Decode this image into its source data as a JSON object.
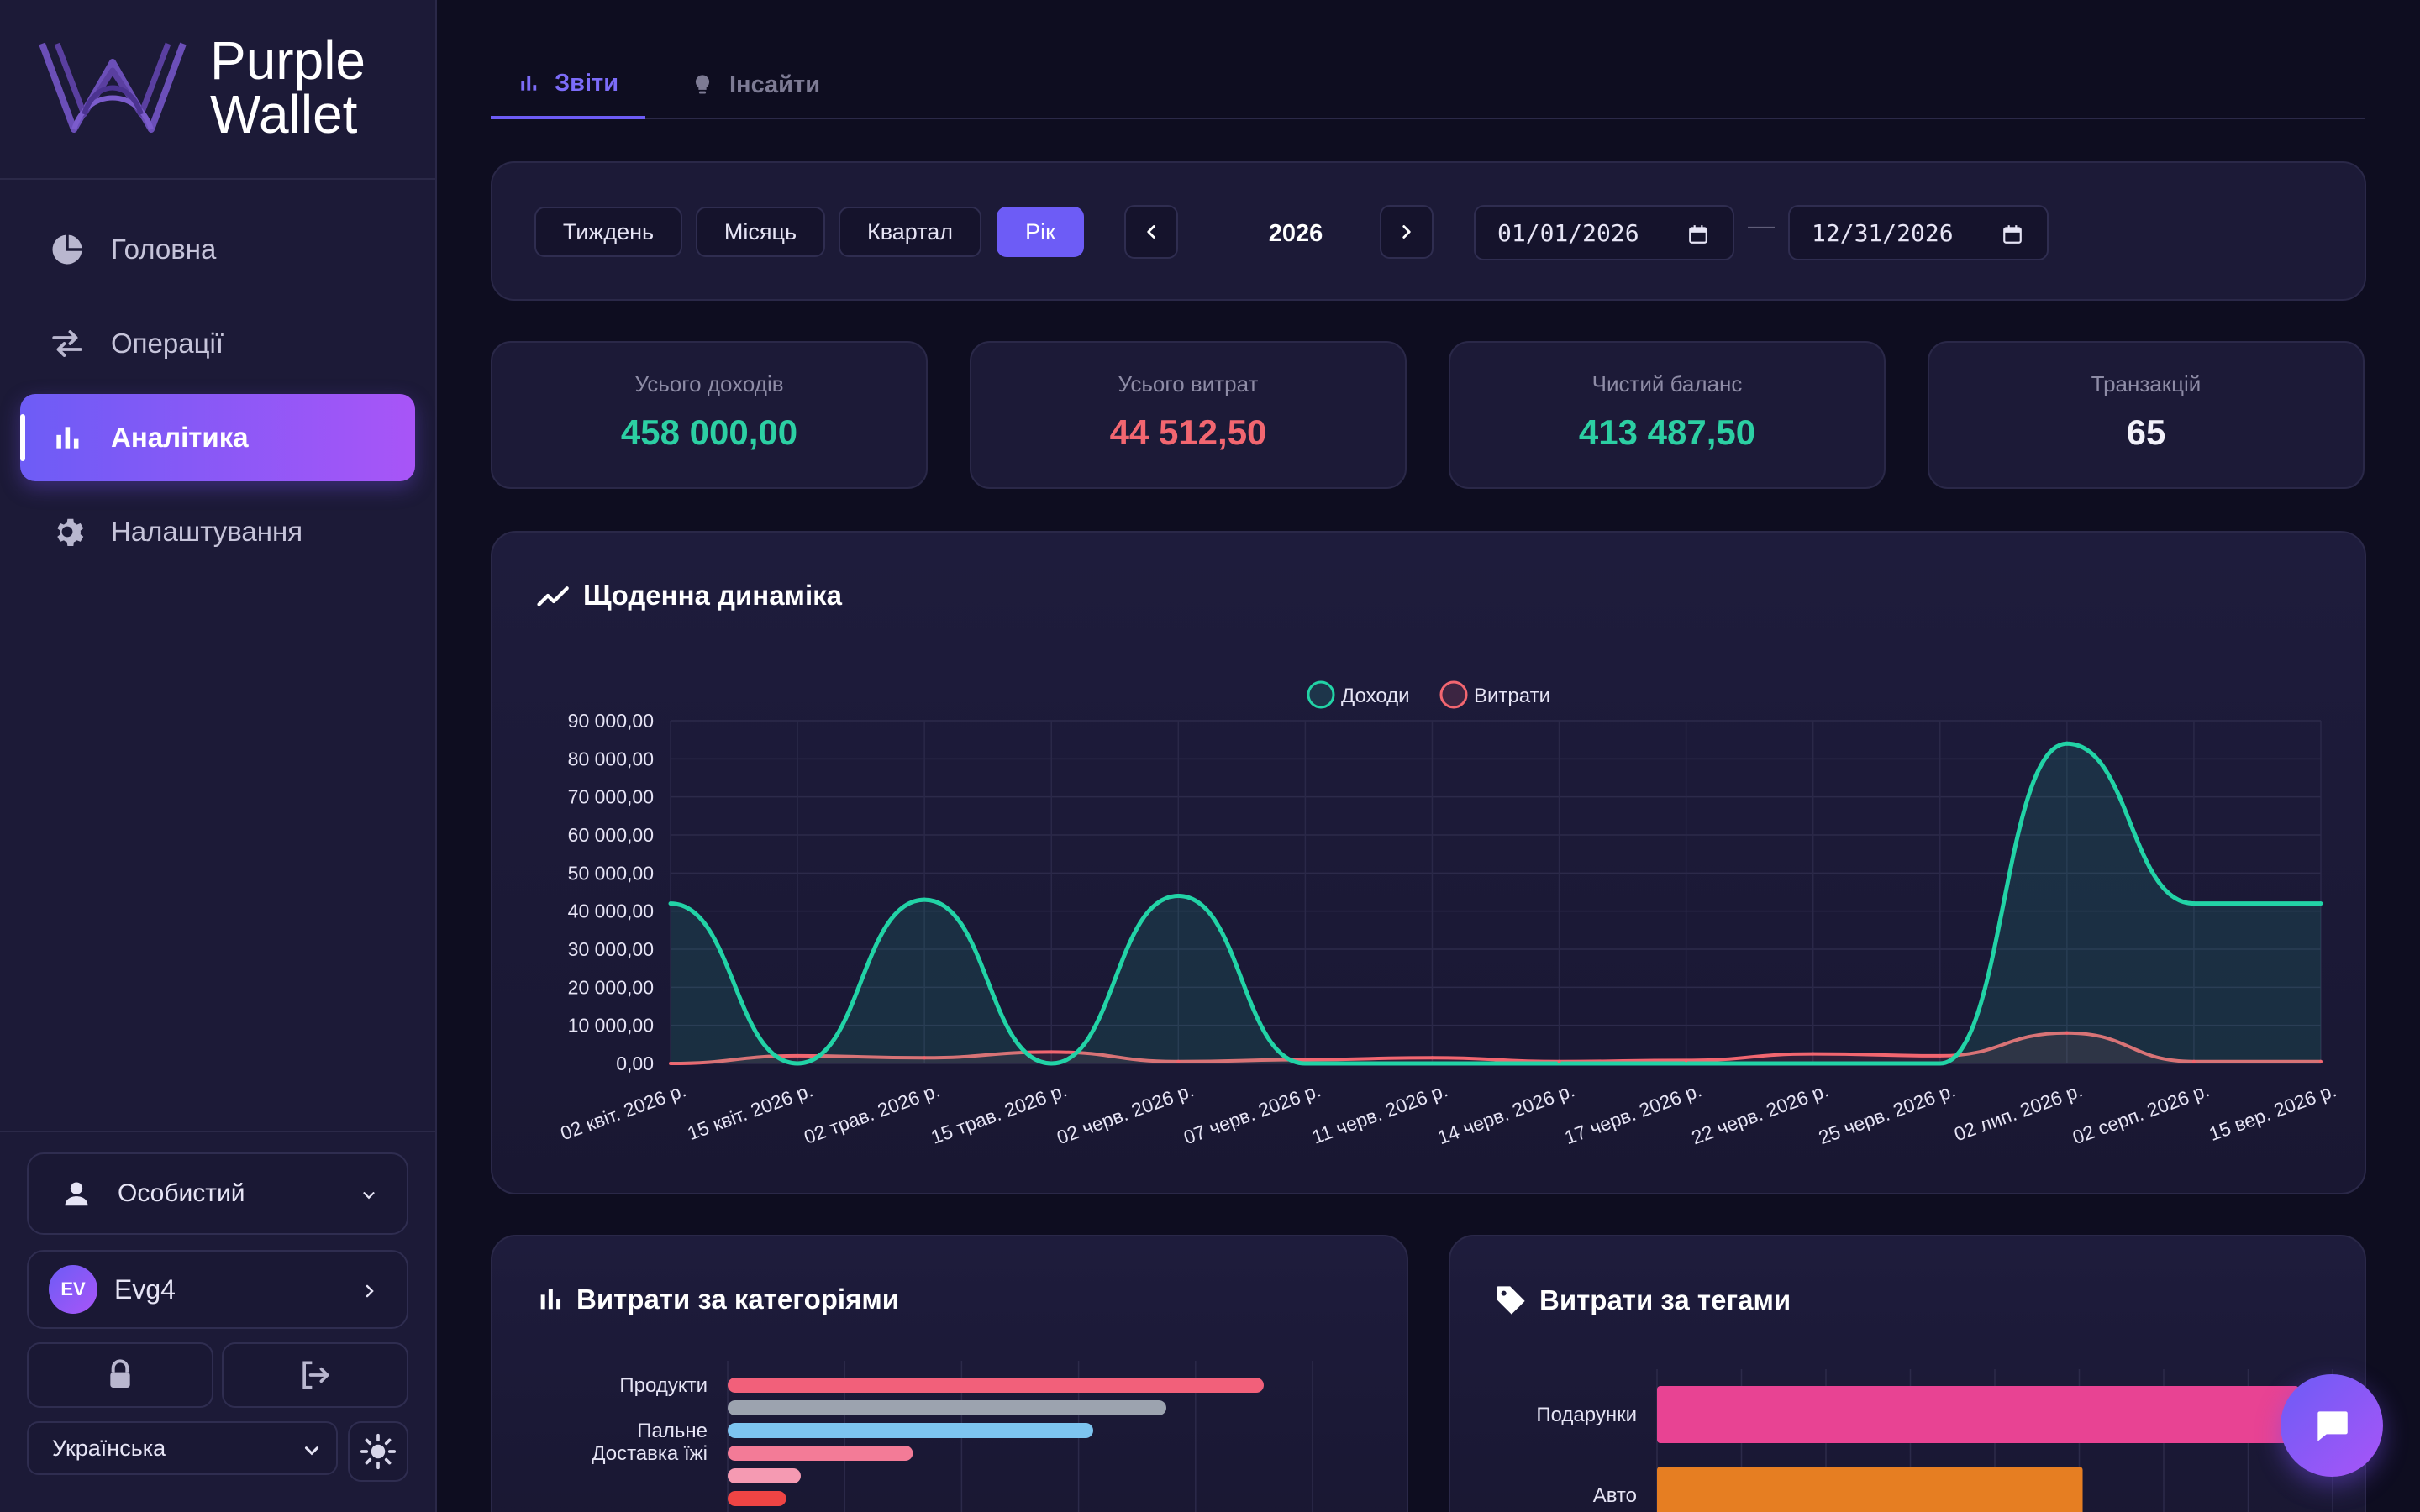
{
  "brand": {
    "line1": "Purple",
    "line2": "Wallet"
  },
  "sidebar": {
    "items": [
      {
        "label": "Головна",
        "icon": "pie-chart-icon"
      },
      {
        "label": "Операції",
        "icon": "swap-arrows-icon"
      },
      {
        "label": "Аналітика",
        "icon": "bar-chart-icon",
        "active": true
      },
      {
        "label": "Налаштування",
        "icon": "gear-icon"
      }
    ],
    "profile": "Особистий",
    "user": {
      "initials": "EV",
      "name": "Evg4"
    },
    "language": "Українська"
  },
  "tabs": [
    {
      "label": "Звіти",
      "active": true,
      "icon": "bar-chart-icon"
    },
    {
      "label": "Інсайти",
      "active": false,
      "icon": "lightbulb-icon"
    }
  ],
  "filters": {
    "periods": [
      "Тиждень",
      "Місяць",
      "Квартал",
      "Рік"
    ],
    "active_period": "Рік",
    "year": "2026",
    "date_from": "01/01/2026",
    "date_to": "12/31/2026",
    "separator": "—"
  },
  "stats": [
    {
      "label": "Усього доходів",
      "value": "458 000,00",
      "color": "#2ccfa3"
    },
    {
      "label": "Усього витрат",
      "value": "44 512,50",
      "color": "#f26670"
    },
    {
      "label": "Чистий баланс",
      "value": "413 487,50",
      "color": "#2ccfa3"
    },
    {
      "label": "Транзакцій",
      "value": "65",
      "color": "#f2f1fa"
    }
  ],
  "daily_chart": {
    "title": "Щоденна динаміка",
    "legend": [
      "Доходи",
      "Витрати"
    ],
    "colors": {
      "income": "#22d3a6",
      "expense": "#f26670"
    }
  },
  "category_chart": {
    "title": "Витрати за категоріями",
    "labels": [
      "Продукти",
      "Пальне",
      "Доставка їжі"
    ]
  },
  "tags_chart": {
    "title": "Витрати за тегами",
    "labels": [
      "Подарунки",
      "Авто"
    ]
  },
  "chart_data": [
    {
      "type": "line",
      "title": "Щоденна динаміка",
      "x": [
        "02 квіт. 2026 р.",
        "15 квіт. 2026 р.",
        "02 трав. 2026 р.",
        "15 трав. 2026 р.",
        "02 черв. 2026 р.",
        "07 черв. 2026 р.",
        "11 черв. 2026 р.",
        "14 черв. 2026 р.",
        "17 черв. 2026 р.",
        "22 черв. 2026 р.",
        "25 черв. 2026 р.",
        "02 лип. 2026 р.",
        "02 серп. 2026 р.",
        "15 вер. 2026 р."
      ],
      "yticks": [
        "90 000,00",
        "80 000,00",
        "70 000,00",
        "60 000,00",
        "50 000,00",
        "40 000,00",
        "30 000,00",
        "20 000,00",
        "10 000,00",
        "0,00"
      ],
      "ylim": [
        0,
        90000
      ],
      "series": [
        {
          "name": "Доходи",
          "values": [
            42000,
            0,
            43000,
            0,
            44000,
            0,
            0,
            0,
            0,
            0,
            0,
            84000,
            42000,
            42000
          ]
        },
        {
          "name": "Витрати",
          "values": [
            0,
            2000,
            1500,
            3000,
            500,
            1000,
            1500,
            500,
            800,
            2500,
            2000,
            8000,
            500,
            500
          ]
        }
      ]
    },
    {
      "type": "bar",
      "title": "Витрати за категоріями",
      "categories": [
        "Продукти",
        "",
        "Пальне",
        "Доставка їжі",
        "",
        ""
      ],
      "values": [
        11000,
        9000,
        7500,
        3800,
        1500,
        1200
      ],
      "colors": [
        "#f2607a",
        "#9ca3af",
        "#7dc4f0",
        "#f37b97",
        "#f59ab2",
        "#ef4444"
      ],
      "xlim": [
        0,
        12000
      ]
    },
    {
      "type": "bar",
      "title": "Витрати за тегами",
      "categories": [
        "Подарунки",
        "Авто"
      ],
      "values": [
        9500,
        6300
      ],
      "colors": [
        "#e84393",
        "#e67e22"
      ],
      "xlim": [
        0,
        10000
      ]
    }
  ]
}
